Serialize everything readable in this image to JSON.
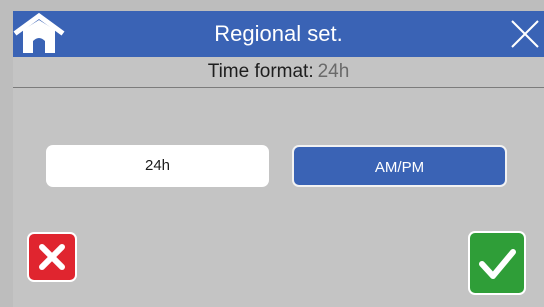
{
  "header": {
    "title": "Regional set."
  },
  "setting": {
    "label": "Time format:",
    "value": "24h"
  },
  "options": [
    {
      "label": "24h",
      "selected": false
    },
    {
      "label": "AM/PM",
      "selected": true
    }
  ],
  "icons": {
    "home": "home-icon",
    "close": "close-icon",
    "cancel": "x-icon",
    "confirm": "checkmark-icon"
  },
  "colors": {
    "header_bg": "#3a63b5",
    "screen_bg": "#c4c4c4",
    "selected_option": "#3a63b5",
    "cancel": "#e0252f",
    "confirm": "#2f9e38"
  }
}
